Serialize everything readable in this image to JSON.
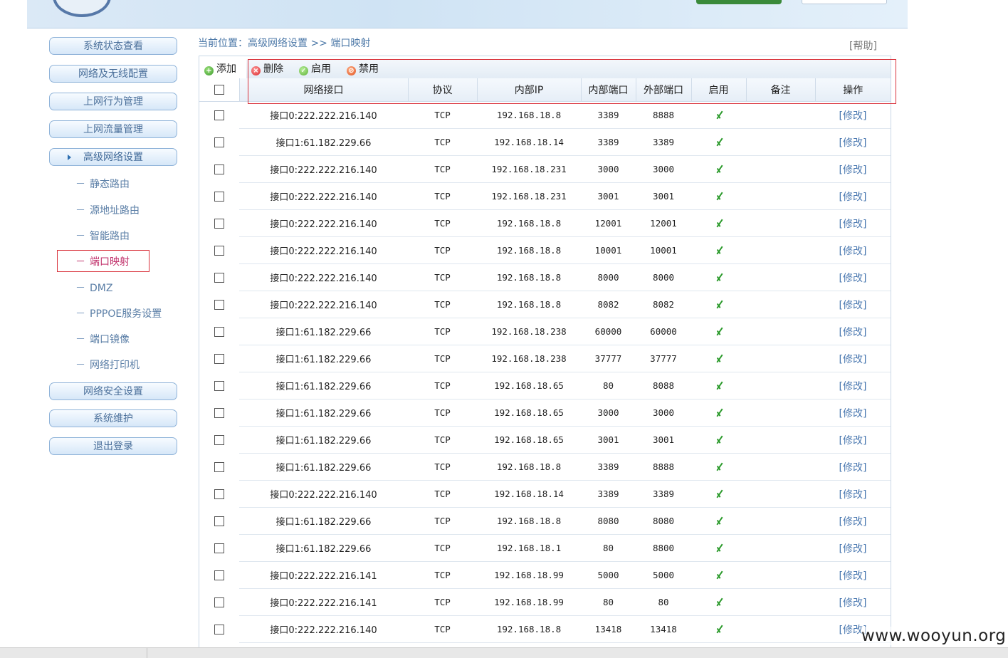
{
  "sidebar": {
    "main_items": [
      {
        "label": "系统状态查看"
      },
      {
        "label": "网络及无线配置"
      },
      {
        "label": "上网行为管理"
      },
      {
        "label": "上网流量管理"
      },
      {
        "label": "高级网络设置"
      }
    ],
    "sub_items": [
      {
        "label": "静态路由"
      },
      {
        "label": "源地址路由"
      },
      {
        "label": "智能路由"
      },
      {
        "label": "端口映射"
      },
      {
        "label": "DMZ"
      },
      {
        "label": "PPPOE服务设置"
      },
      {
        "label": "端口镜像"
      },
      {
        "label": "网络打印机"
      }
    ],
    "bottom_items": [
      {
        "label": "网络安全设置"
      },
      {
        "label": "系统维护"
      },
      {
        "label": "退出登录"
      }
    ],
    "dash": "－"
  },
  "breadcrumb": "当前位置：高级网络设置 >> 端口映射",
  "help_label": "[帮助]",
  "toolbar": {
    "add_label": "添加",
    "delete_label": "删除",
    "enable_label": "启用",
    "disable_label": "禁用"
  },
  "table": {
    "headers": [
      "网络接口",
      "协议",
      "内部IP",
      "内部端口",
      "外部端口",
      "启用",
      "备注",
      "操作"
    ],
    "edit_label": "[修改]",
    "rows": [
      {
        "iface": "接口0:222.222.216.140",
        "proto": "TCP",
        "ip": "192.168.18.8",
        "in_port": "3389",
        "out_port": "8888",
        "enabled": true,
        "note": ""
      },
      {
        "iface": "接口1:61.182.229.66",
        "proto": "TCP",
        "ip": "192.168.18.14",
        "in_port": "3389",
        "out_port": "3389",
        "enabled": true,
        "note": ""
      },
      {
        "iface": "接口0:222.222.216.140",
        "proto": "TCP",
        "ip": "192.168.18.231",
        "in_port": "3000",
        "out_port": "3000",
        "enabled": true,
        "note": ""
      },
      {
        "iface": "接口0:222.222.216.140",
        "proto": "TCP",
        "ip": "192.168.18.231",
        "in_port": "3001",
        "out_port": "3001",
        "enabled": true,
        "note": ""
      },
      {
        "iface": "接口0:222.222.216.140",
        "proto": "TCP",
        "ip": "192.168.18.8",
        "in_port": "12001",
        "out_port": "12001",
        "enabled": true,
        "note": ""
      },
      {
        "iface": "接口0:222.222.216.140",
        "proto": "TCP",
        "ip": "192.168.18.8",
        "in_port": "10001",
        "out_port": "10001",
        "enabled": true,
        "note": ""
      },
      {
        "iface": "接口0:222.222.216.140",
        "proto": "TCP",
        "ip": "192.168.18.8",
        "in_port": "8000",
        "out_port": "8000",
        "enabled": true,
        "note": ""
      },
      {
        "iface": "接口0:222.222.216.140",
        "proto": "TCP",
        "ip": "192.168.18.8",
        "in_port": "8082",
        "out_port": "8082",
        "enabled": true,
        "note": ""
      },
      {
        "iface": "接口1:61.182.229.66",
        "proto": "TCP",
        "ip": "192.168.18.238",
        "in_port": "60000",
        "out_port": "60000",
        "enabled": true,
        "note": ""
      },
      {
        "iface": "接口1:61.182.229.66",
        "proto": "TCP",
        "ip": "192.168.18.238",
        "in_port": "37777",
        "out_port": "37777",
        "enabled": true,
        "note": ""
      },
      {
        "iface": "接口1:61.182.229.66",
        "proto": "TCP",
        "ip": "192.168.18.65",
        "in_port": "80",
        "out_port": "8088",
        "enabled": true,
        "note": ""
      },
      {
        "iface": "接口1:61.182.229.66",
        "proto": "TCP",
        "ip": "192.168.18.65",
        "in_port": "3000",
        "out_port": "3000",
        "enabled": true,
        "note": ""
      },
      {
        "iface": "接口1:61.182.229.66",
        "proto": "TCP",
        "ip": "192.168.18.65",
        "in_port": "3001",
        "out_port": "3001",
        "enabled": true,
        "note": ""
      },
      {
        "iface": "接口1:61.182.229.66",
        "proto": "TCP",
        "ip": "192.168.18.8",
        "in_port": "3389",
        "out_port": "8888",
        "enabled": true,
        "note": ""
      },
      {
        "iface": "接口0:222.222.216.140",
        "proto": "TCP",
        "ip": "192.168.18.14",
        "in_port": "3389",
        "out_port": "3389",
        "enabled": true,
        "note": ""
      },
      {
        "iface": "接口1:61.182.229.66",
        "proto": "TCP",
        "ip": "192.168.18.8",
        "in_port": "8080",
        "out_port": "8080",
        "enabled": true,
        "note": ""
      },
      {
        "iface": "接口1:61.182.229.66",
        "proto": "TCP",
        "ip": "192.168.18.1",
        "in_port": "80",
        "out_port": "8800",
        "enabled": true,
        "note": ""
      },
      {
        "iface": "接口0:222.222.216.141",
        "proto": "TCP",
        "ip": "192.168.18.99",
        "in_port": "5000",
        "out_port": "5000",
        "enabled": true,
        "note": ""
      },
      {
        "iface": "接口0:222.222.216.141",
        "proto": "TCP",
        "ip": "192.168.18.99",
        "in_port": "80",
        "out_port": "80",
        "enabled": true,
        "note": ""
      },
      {
        "iface": "接口0:222.222.216.140",
        "proto": "TCP",
        "ip": "192.168.18.8",
        "in_port": "13418",
        "out_port": "13418",
        "enabled": true,
        "note": ""
      }
    ]
  },
  "watermark": "www.wooyun.org",
  "colors": {
    "accent": "#4a78b0",
    "highlight_border": "#d9303a",
    "check": "#2b9a2b",
    "current_menu": "#c0306a"
  }
}
